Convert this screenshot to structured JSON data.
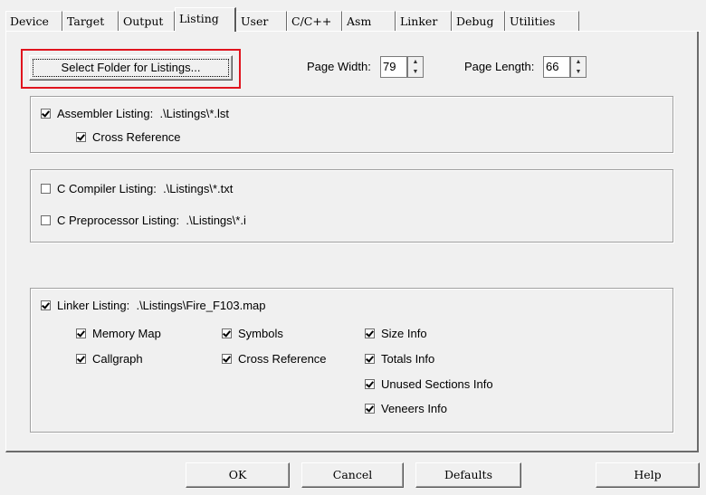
{
  "tabs": [
    "Device",
    "Target",
    "Output",
    "Listing",
    "User",
    "C/C++",
    "Asm",
    "Linker",
    "Debug",
    "Utilities"
  ],
  "active_tab": "Listing",
  "select_folder_button": "Select Folder for Listings...",
  "page_width": {
    "label": "Page Width:",
    "value": "79"
  },
  "page_length": {
    "label": "Page Length:",
    "value": "66"
  },
  "assembler": {
    "label": "Assembler Listing:",
    "path": ".\\Listings\\*.lst",
    "checked": true,
    "cross_reference": {
      "label": "Cross Reference",
      "checked": true
    }
  },
  "c_compiler": {
    "label": "C Compiler Listing:",
    "path": ".\\Listings\\*.txt",
    "checked": false
  },
  "c_preprocessor": {
    "label": "C Preprocessor Listing:",
    "path": ".\\Listings\\*.i",
    "checked": false
  },
  "linker": {
    "label": "Linker Listing:",
    "path": ".\\Listings\\Fire_F103.map",
    "checked": true,
    "options": {
      "memory_map": {
        "label": "Memory Map",
        "checked": true
      },
      "callgraph": {
        "label": "Callgraph",
        "checked": true
      },
      "symbols": {
        "label": "Symbols",
        "checked": true
      },
      "cross_reference": {
        "label": "Cross Reference",
        "checked": true
      },
      "size_info": {
        "label": "Size Info",
        "checked": true
      },
      "totals_info": {
        "label": "Totals Info",
        "checked": true
      },
      "unused_sections_info": {
        "label": "Unused Sections Info",
        "checked": true
      },
      "veneers_info": {
        "label": "Veneers Info",
        "checked": true
      }
    }
  },
  "buttons": {
    "ok": "OK",
    "cancel": "Cancel",
    "defaults": "Defaults",
    "help": "Help"
  }
}
